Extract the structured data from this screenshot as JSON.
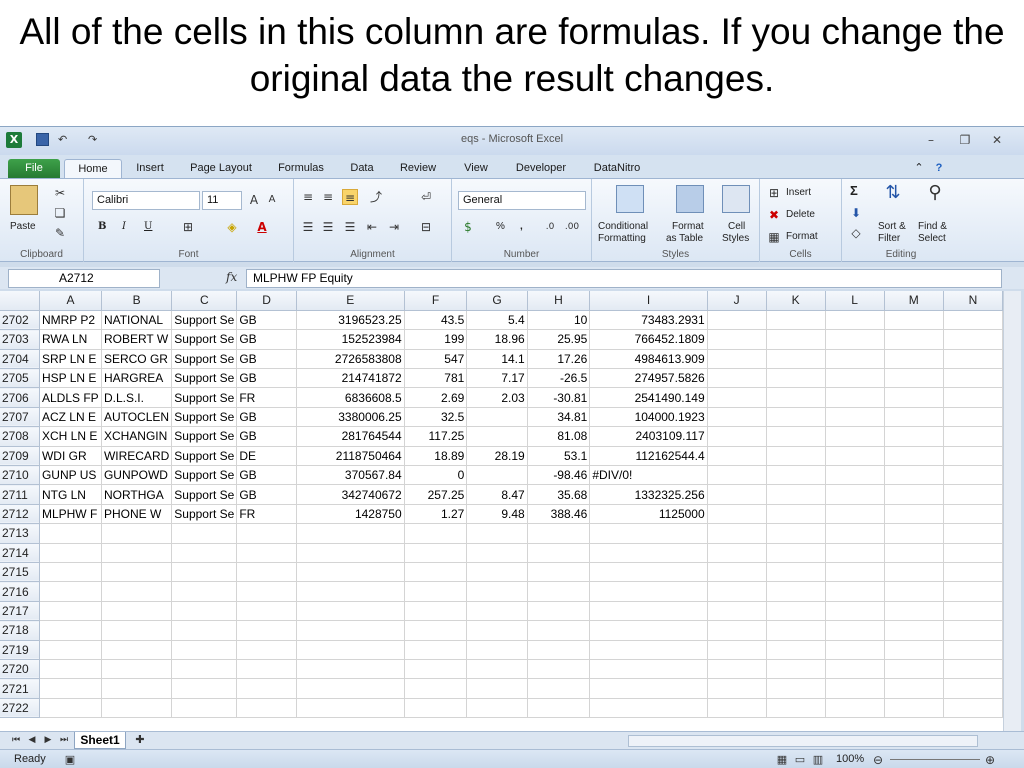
{
  "slide": {
    "title": "All of the cells in this column are formulas. If you change the original data the result changes."
  },
  "window": {
    "title": "eqs - Microsoft Excel",
    "qat_undo": "↶",
    "qat_redo": "↷"
  },
  "ribbon_tabs": [
    "File",
    "Home",
    "Insert",
    "Page Layout",
    "Formulas",
    "Data",
    "Review",
    "View",
    "Developer",
    "DataNitro"
  ],
  "ribbon": {
    "clipboard": {
      "label": "Clipboard",
      "paste": "Paste"
    },
    "font": {
      "label": "Font",
      "name": "Calibri",
      "size": "11",
      "bold": "B",
      "italic": "I",
      "underline": "U"
    },
    "alignment": {
      "label": "Alignment"
    },
    "number": {
      "label": "Number",
      "format": "General",
      "percent": "%",
      "comma": ","
    },
    "styles": {
      "label": "Styles",
      "conditional": "Conditional",
      "formatting": "Formatting",
      "format": "Format",
      "as_table": "as Table",
      "cell": "Cell",
      "cell_styles": "Styles"
    },
    "cells": {
      "label": "Cells",
      "insert": "Insert",
      "delete": "Delete",
      "format": "Format"
    },
    "editing": {
      "label": "Editing",
      "sigma": "Σ",
      "sort": "Sort &",
      "filter": "Filter",
      "find": "Find &",
      "select": "Select"
    }
  },
  "formula_bar": {
    "name_box": "A2712",
    "fx": "fx",
    "content": "MLPHW  FP Equity"
  },
  "columns": [
    "A",
    "B",
    "C",
    "D",
    "E",
    "F",
    "G",
    "H",
    "I",
    "J",
    "K",
    "L",
    "M",
    "N"
  ],
  "rows": [
    {
      "n": "2702",
      "cells": [
        "NMRP   P2",
        "NATIONAL",
        "Support Se",
        "GB",
        "3196523.25",
        "43.5",
        "5.4",
        "10",
        "73483.2931"
      ]
    },
    {
      "n": "2703",
      "cells": [
        "RWA     LN",
        "ROBERT W",
        "Support Se",
        "GB",
        "152523984",
        "199",
        "18.96",
        "25.95",
        "766452.1809"
      ]
    },
    {
      "n": "2704",
      "cells": [
        "SRP     LN E",
        "SERCO GR",
        "Support Se",
        "GB",
        "2726583808",
        "547",
        "14.1",
        "17.26",
        "4984613.909"
      ]
    },
    {
      "n": "2705",
      "cells": [
        "HSP     LN E",
        "HARGREA",
        "Support Se",
        "GB",
        "214741872",
        "781",
        "7.17",
        "-26.5",
        "274957.5826"
      ]
    },
    {
      "n": "2706",
      "cells": [
        "ALDLS   FP",
        "D.L.S.I.",
        "Support Se",
        "FR",
        "6836608.5",
        "2.69",
        "2.03",
        "-30.81",
        "2541490.149"
      ]
    },
    {
      "n": "2707",
      "cells": [
        "ACZ     LN E",
        "AUTOCLEN",
        "Support Se",
        "GB",
        "3380006.25",
        "32.5",
        "",
        "34.81",
        "104000.1923"
      ]
    },
    {
      "n": "2708",
      "cells": [
        "XCH     LN E",
        "XCHANGIN",
        "Support Se",
        "GB",
        "281764544",
        "117.25",
        "",
        "81.08",
        "2403109.117"
      ]
    },
    {
      "n": "2709",
      "cells": [
        "WDI     GR",
        "WIRECARD",
        "Support Se",
        "DE",
        "2118750464",
        "18.89",
        "28.19",
        "53.1",
        "112162544.4"
      ]
    },
    {
      "n": "2710",
      "cells": [
        "GUNP    US",
        "GUNPOWD",
        "Support Se",
        "GB",
        "370567.84",
        "0",
        "",
        "-98.46",
        "#DIV/0!"
      ]
    },
    {
      "n": "2711",
      "cells": [
        "NTG     LN",
        "NORTHGA",
        "Support Se",
        "GB",
        "342740672",
        "257.25",
        "8.47",
        "35.68",
        "1332325.256"
      ]
    },
    {
      "n": "2712",
      "cells": [
        "MLPHW   F",
        "PHONE W",
        "Support Se",
        "FR",
        "1428750",
        "1.27",
        "9.48",
        "388.46",
        "1125000"
      ]
    },
    {
      "n": "2713",
      "cells": [
        "",
        "",
        "",
        "",
        "",
        "",
        "",
        "",
        ""
      ]
    },
    {
      "n": "2714",
      "cells": [
        "",
        "",
        "",
        "",
        "",
        "",
        "",
        "",
        ""
      ]
    },
    {
      "n": "2715",
      "cells": [
        "",
        "",
        "",
        "",
        "",
        "",
        "",
        "",
        ""
      ]
    },
    {
      "n": "2716",
      "cells": [
        "",
        "",
        "",
        "",
        "",
        "",
        "",
        "",
        ""
      ]
    },
    {
      "n": "2717",
      "cells": [
        "",
        "",
        "",
        "",
        "",
        "",
        "",
        "",
        ""
      ]
    },
    {
      "n": "2718",
      "cells": [
        "",
        "",
        "",
        "",
        "",
        "",
        "",
        "",
        ""
      ]
    },
    {
      "n": "2719",
      "cells": [
        "",
        "",
        "",
        "",
        "",
        "",
        "",
        "",
        ""
      ]
    },
    {
      "n": "2720",
      "cells": [
        "",
        "",
        "",
        "",
        "",
        "",
        "",
        "",
        ""
      ]
    },
    {
      "n": "2721",
      "cells": [
        "",
        "",
        "",
        "",
        "",
        "",
        "",
        "",
        ""
      ]
    },
    {
      "n": "2722",
      "cells": [
        "",
        "",
        "",
        "",
        "",
        "",
        "",
        "",
        ""
      ]
    }
  ],
  "sheet_tab": "Sheet1",
  "status": {
    "ready": "Ready",
    "zoom": "100%"
  }
}
